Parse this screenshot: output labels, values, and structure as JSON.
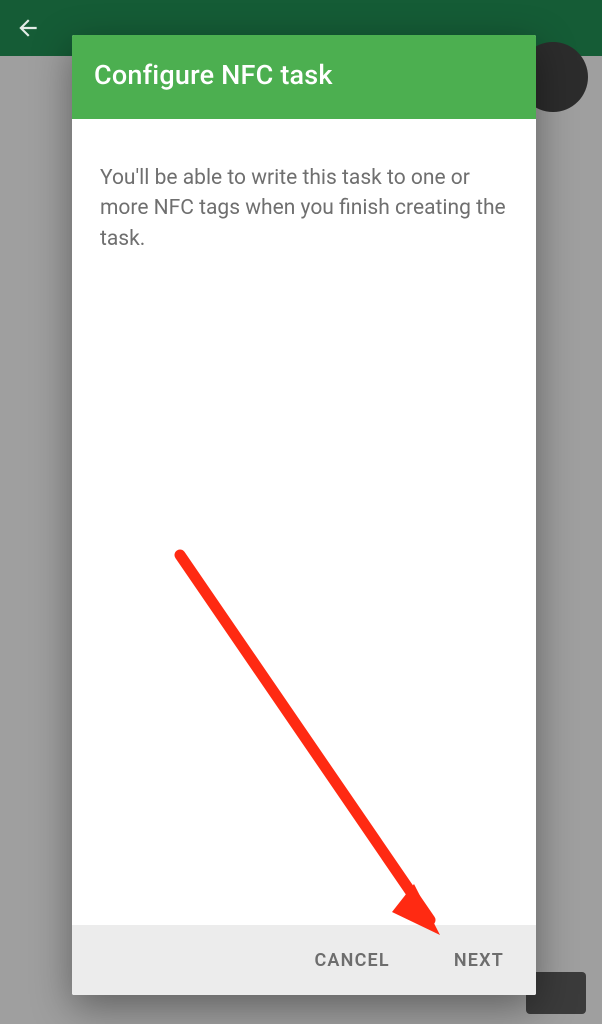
{
  "dialog": {
    "title": "Configure NFC task",
    "body_text": "You'll be able to write this task to one or more NFC tags when you finish creating the task.",
    "cancel_label": "CANCEL",
    "next_label": "NEXT"
  },
  "colors": {
    "accent": "#4caf50",
    "appbar": "#155c36",
    "annotation": "#ff2a12"
  }
}
